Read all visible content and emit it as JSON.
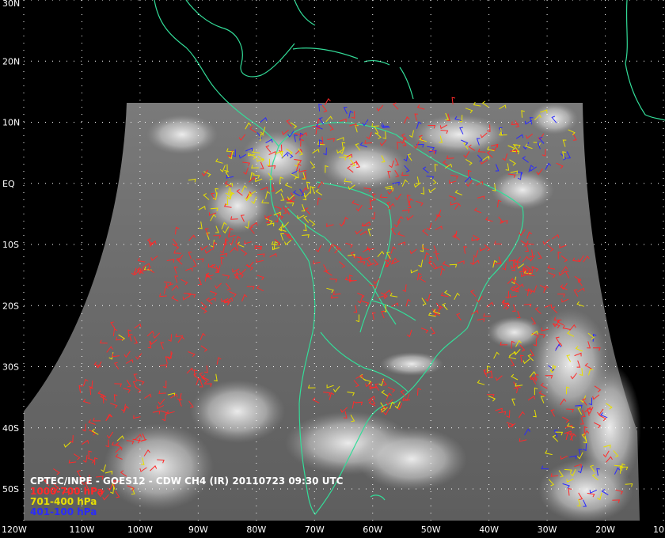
{
  "map": {
    "title": "CPTEC/INPE - GOES12 - CDW CH4 (IR) 20110723 09:30 UTC",
    "lat_labels": [
      "30N",
      "20N",
      "10N",
      "EQ",
      "10S",
      "20S",
      "30S",
      "40S",
      "50S"
    ],
    "lat_values": [
      30,
      20,
      10,
      0,
      -10,
      -20,
      -30,
      -40,
      -50
    ],
    "lon_labels": [
      "120W",
      "110W",
      "100W",
      "90W",
      "80W",
      "70W",
      "60W",
      "50W",
      "40W",
      "30W",
      "20W",
      "10"
    ],
    "lon_values": [
      -120,
      -110,
      -100,
      -90,
      -80,
      -70,
      -60,
      -50,
      -40,
      -30,
      -20,
      -10
    ],
    "coast_color": "#33dd99",
    "grid_color": "#ffffff",
    "legend": [
      {
        "label": "1000-700 hPa",
        "color": "#ff2a2a"
      },
      {
        "label": "701-400 hPa",
        "color": "#e8e000"
      },
      {
        "label": "401-100 hPa",
        "color": "#2a2aff"
      }
    ]
  }
}
